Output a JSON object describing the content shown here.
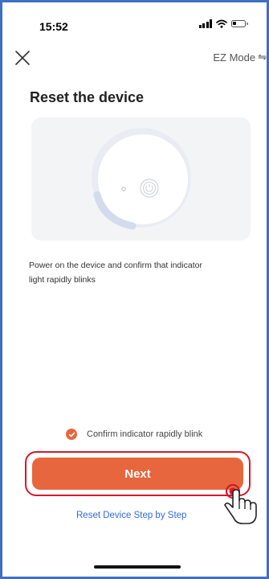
{
  "status_bar": {
    "time": "15:52"
  },
  "nav": {
    "close_icon": "close-icon",
    "mode_label": "EZ Mode",
    "mode_icon": "⇋"
  },
  "page": {
    "title": "Reset the device",
    "description": "Power on the device and confirm that indicator light rapidly blinks",
    "confirm_label": "Confirm indicator rapidly blink",
    "confirm_checked": true,
    "next_label": "Next",
    "step_link": "Reset Device Step by Step"
  },
  "colors": {
    "accent": "#e8663d",
    "link": "#2f6bd8",
    "highlight_outline": "#d41a2a",
    "frame_border": "#3d6fc4"
  }
}
